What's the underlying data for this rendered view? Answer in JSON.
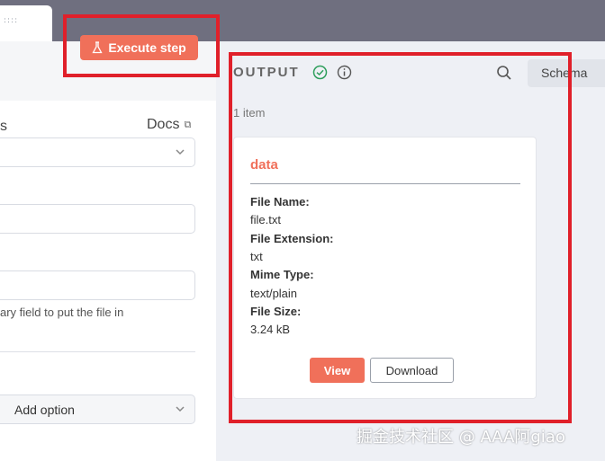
{
  "toolbar": {
    "drag_handle": "::::",
    "execute_label": "Execute step"
  },
  "left": {
    "params_tail": "s",
    "docs_label": "Docs",
    "field_hint": "ary field to put the file in",
    "add_option_label": "Add option"
  },
  "output": {
    "title": "OUTPUT",
    "schema_tab": "Schema",
    "item_count": "1 item",
    "card": {
      "title": "data",
      "fields": [
        {
          "key": "File Name:",
          "value": "file.txt"
        },
        {
          "key": "File Extension:",
          "value": "txt"
        },
        {
          "key": "Mime Type:",
          "value": "text/plain"
        },
        {
          "key": "File Size:",
          "value": "3.24 kB"
        }
      ],
      "view_label": "View",
      "download_label": "Download"
    }
  },
  "watermark": "掘金技术社区 @ AAA阿giao",
  "colors": {
    "accent": "#f0705a",
    "highlight": "#e0202a",
    "success": "#2e9e5b"
  }
}
